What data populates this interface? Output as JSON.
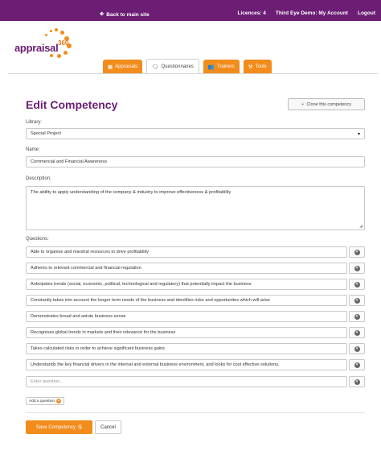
{
  "topbar": {
    "back_label": "Back to main site",
    "licences": "Licences: 4",
    "account": "Third Eye Demo: My Account",
    "logout": "Logout"
  },
  "logo": {
    "text": "appraisal",
    "sup": "360"
  },
  "tabs": [
    {
      "label": "Appraisals",
      "icon": "calendar-icon"
    },
    {
      "label": "Questionnaires",
      "icon": "questionnaire-icon"
    },
    {
      "label": "Trainers",
      "icon": "users-icon"
    },
    {
      "label": "Tools",
      "icon": "tools-icon"
    }
  ],
  "page": {
    "title": "Edit Competency",
    "clone_label": "Clone this competency"
  },
  "form": {
    "library_label": "Library:",
    "library_value": "Special Project",
    "name_label": "Name:",
    "name_value": "Commercial and Financial Awareness",
    "description_label": "Description:",
    "description_value": "The ability to apply understanding of the company & industry to improve effectiveness & profitability",
    "questions_label": "Questions:",
    "questions": [
      "Able to organise and marshal resources to drive profitability",
      "Adheres to relevant commercial and financial regulation",
      "Anticipates trends (social, economic, political, technological and regulatory) that potentially impact the business",
      "Constantly takes into account the longer term needs of the business and identifies risks and opportunites which will arise",
      "Demonstrates broad and astute business sense",
      "Recognises global trends in markets and their relevance for the business",
      "Takes calculated risks in order to achieve significant business gains",
      "Understands the key financial drivers in the internal and external business environment, and looks for cost effective solutions."
    ],
    "new_question_placeholder": "Enter question...",
    "add_question_label": "Add a question",
    "save_label": "Save Competency",
    "cancel_label": "Cancel"
  },
  "colors": {
    "brand_purple": "#6b1e74",
    "accent_orange": "#f28c1c"
  }
}
